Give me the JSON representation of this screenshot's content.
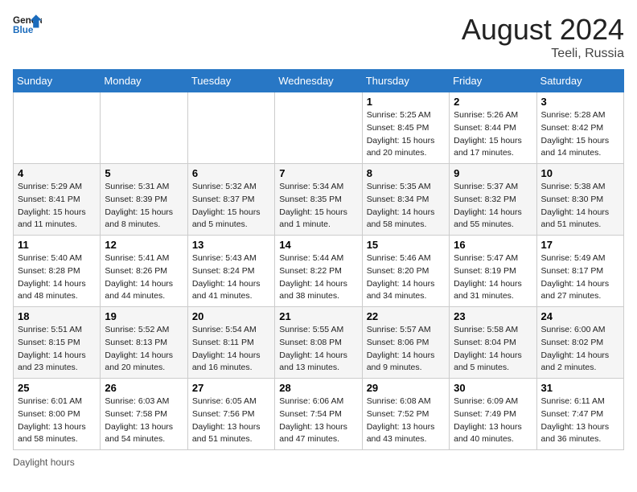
{
  "header": {
    "logo_line1": "General",
    "logo_line2": "Blue",
    "month_year": "August 2024",
    "location": "Teeli, Russia"
  },
  "days_of_week": [
    "Sunday",
    "Monday",
    "Tuesday",
    "Wednesday",
    "Thursday",
    "Friday",
    "Saturday"
  ],
  "weeks": [
    [
      {
        "day": "",
        "info": ""
      },
      {
        "day": "",
        "info": ""
      },
      {
        "day": "",
        "info": ""
      },
      {
        "day": "",
        "info": ""
      },
      {
        "day": "1",
        "info": "Sunrise: 5:25 AM\nSunset: 8:45 PM\nDaylight: 15 hours and 20 minutes."
      },
      {
        "day": "2",
        "info": "Sunrise: 5:26 AM\nSunset: 8:44 PM\nDaylight: 15 hours and 17 minutes."
      },
      {
        "day": "3",
        "info": "Sunrise: 5:28 AM\nSunset: 8:42 PM\nDaylight: 15 hours and 14 minutes."
      }
    ],
    [
      {
        "day": "4",
        "info": "Sunrise: 5:29 AM\nSunset: 8:41 PM\nDaylight: 15 hours and 11 minutes."
      },
      {
        "day": "5",
        "info": "Sunrise: 5:31 AM\nSunset: 8:39 PM\nDaylight: 15 hours and 8 minutes."
      },
      {
        "day": "6",
        "info": "Sunrise: 5:32 AM\nSunset: 8:37 PM\nDaylight: 15 hours and 5 minutes."
      },
      {
        "day": "7",
        "info": "Sunrise: 5:34 AM\nSunset: 8:35 PM\nDaylight: 15 hours and 1 minute."
      },
      {
        "day": "8",
        "info": "Sunrise: 5:35 AM\nSunset: 8:34 PM\nDaylight: 14 hours and 58 minutes."
      },
      {
        "day": "9",
        "info": "Sunrise: 5:37 AM\nSunset: 8:32 PM\nDaylight: 14 hours and 55 minutes."
      },
      {
        "day": "10",
        "info": "Sunrise: 5:38 AM\nSunset: 8:30 PM\nDaylight: 14 hours and 51 minutes."
      }
    ],
    [
      {
        "day": "11",
        "info": "Sunrise: 5:40 AM\nSunset: 8:28 PM\nDaylight: 14 hours and 48 minutes."
      },
      {
        "day": "12",
        "info": "Sunrise: 5:41 AM\nSunset: 8:26 PM\nDaylight: 14 hours and 44 minutes."
      },
      {
        "day": "13",
        "info": "Sunrise: 5:43 AM\nSunset: 8:24 PM\nDaylight: 14 hours and 41 minutes."
      },
      {
        "day": "14",
        "info": "Sunrise: 5:44 AM\nSunset: 8:22 PM\nDaylight: 14 hours and 38 minutes."
      },
      {
        "day": "15",
        "info": "Sunrise: 5:46 AM\nSunset: 8:20 PM\nDaylight: 14 hours and 34 minutes."
      },
      {
        "day": "16",
        "info": "Sunrise: 5:47 AM\nSunset: 8:19 PM\nDaylight: 14 hours and 31 minutes."
      },
      {
        "day": "17",
        "info": "Sunrise: 5:49 AM\nSunset: 8:17 PM\nDaylight: 14 hours and 27 minutes."
      }
    ],
    [
      {
        "day": "18",
        "info": "Sunrise: 5:51 AM\nSunset: 8:15 PM\nDaylight: 14 hours and 23 minutes."
      },
      {
        "day": "19",
        "info": "Sunrise: 5:52 AM\nSunset: 8:13 PM\nDaylight: 14 hours and 20 minutes."
      },
      {
        "day": "20",
        "info": "Sunrise: 5:54 AM\nSunset: 8:11 PM\nDaylight: 14 hours and 16 minutes."
      },
      {
        "day": "21",
        "info": "Sunrise: 5:55 AM\nSunset: 8:08 PM\nDaylight: 14 hours and 13 minutes."
      },
      {
        "day": "22",
        "info": "Sunrise: 5:57 AM\nSunset: 8:06 PM\nDaylight: 14 hours and 9 minutes."
      },
      {
        "day": "23",
        "info": "Sunrise: 5:58 AM\nSunset: 8:04 PM\nDaylight: 14 hours and 5 minutes."
      },
      {
        "day": "24",
        "info": "Sunrise: 6:00 AM\nSunset: 8:02 PM\nDaylight: 14 hours and 2 minutes."
      }
    ],
    [
      {
        "day": "25",
        "info": "Sunrise: 6:01 AM\nSunset: 8:00 PM\nDaylight: 13 hours and 58 minutes."
      },
      {
        "day": "26",
        "info": "Sunrise: 6:03 AM\nSunset: 7:58 PM\nDaylight: 13 hours and 54 minutes."
      },
      {
        "day": "27",
        "info": "Sunrise: 6:05 AM\nSunset: 7:56 PM\nDaylight: 13 hours and 51 minutes."
      },
      {
        "day": "28",
        "info": "Sunrise: 6:06 AM\nSunset: 7:54 PM\nDaylight: 13 hours and 47 minutes."
      },
      {
        "day": "29",
        "info": "Sunrise: 6:08 AM\nSunset: 7:52 PM\nDaylight: 13 hours and 43 minutes."
      },
      {
        "day": "30",
        "info": "Sunrise: 6:09 AM\nSunset: 7:49 PM\nDaylight: 13 hours and 40 minutes."
      },
      {
        "day": "31",
        "info": "Sunrise: 6:11 AM\nSunset: 7:47 PM\nDaylight: 13 hours and 36 minutes."
      }
    ]
  ],
  "footer": {
    "label": "Daylight hours"
  }
}
